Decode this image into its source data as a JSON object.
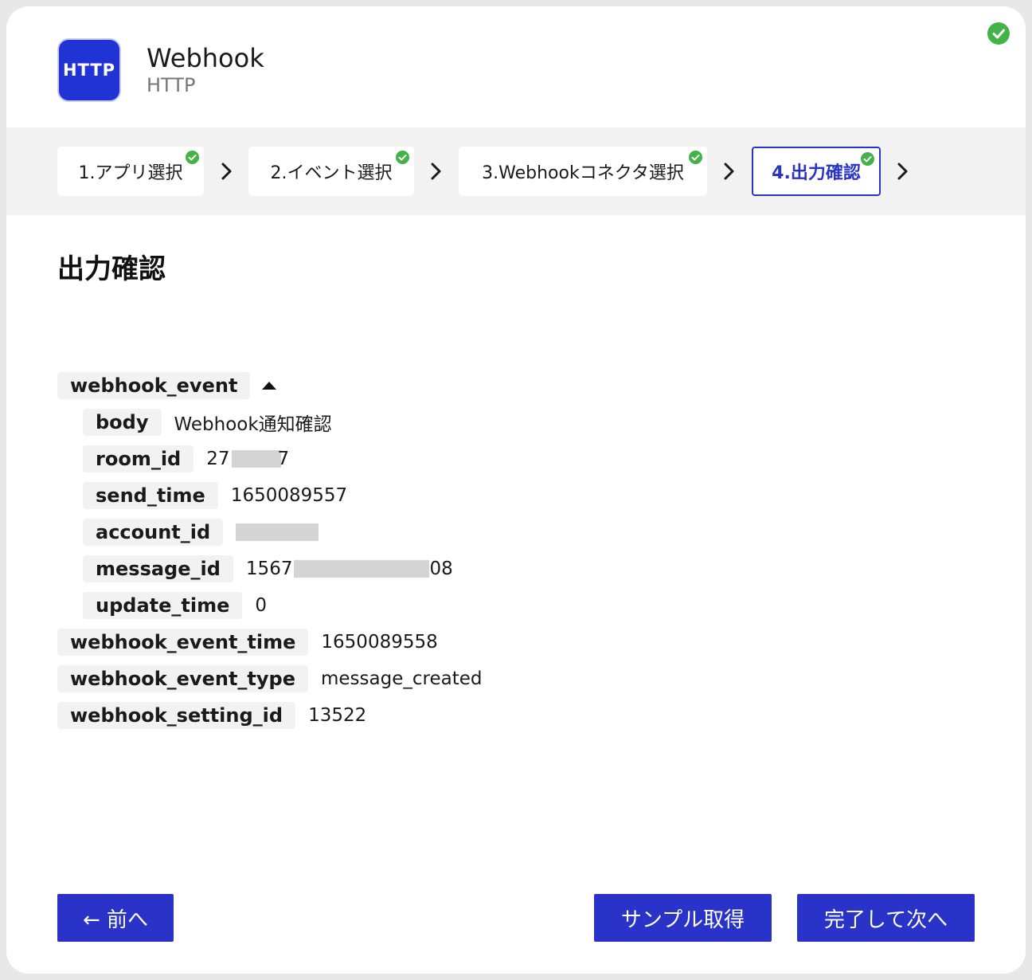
{
  "app": {
    "logo_text": "HTTP",
    "title": "Webhook",
    "subtitle": "HTTP"
  },
  "steps": [
    {
      "label": "1.アプリ選択",
      "done": true
    },
    {
      "label": "2.イベント選択",
      "done": true
    },
    {
      "label": "3.Webhookコネクタ選択",
      "done": true
    },
    {
      "label": "4.出力確認",
      "done": true,
      "active": true
    }
  ],
  "section_title": "出力確認",
  "output": {
    "root": {
      "key": "webhook_event",
      "expanded": true
    },
    "children": [
      {
        "key": "body",
        "value": "Webhook通知確認"
      },
      {
        "key": "room_id",
        "value_prefix": "27",
        "value_suffix": "7",
        "masked": true
      },
      {
        "key": "send_time",
        "value": "1650089557"
      },
      {
        "key": "account_id",
        "value": "",
        "masked": true
      },
      {
        "key": "message_id",
        "value_prefix": "1567",
        "value_suffix": "08",
        "masked": true
      },
      {
        "key": "update_time",
        "value": "0"
      }
    ],
    "siblings": [
      {
        "key": "webhook_event_time",
        "value": "1650089558"
      },
      {
        "key": "webhook_event_type",
        "value": "message_created"
      },
      {
        "key": "webhook_setting_id",
        "value": "13522"
      }
    ]
  },
  "buttons": {
    "back": "← 前へ",
    "sample": "サンプル取得",
    "next": "完了して次へ"
  },
  "colors": {
    "primary": "#2a33c8",
    "success": "#43b348",
    "key_bg": "#f2f2f2"
  }
}
